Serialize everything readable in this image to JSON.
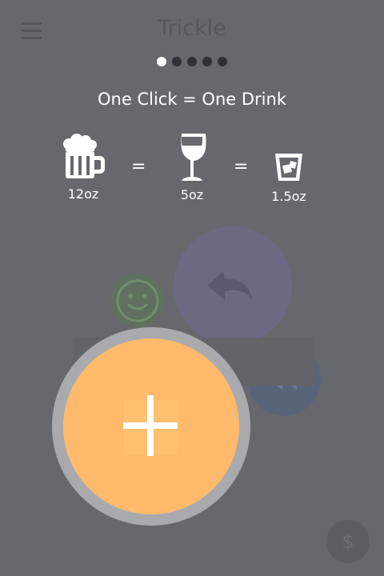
{
  "app": {
    "title": "Trickle"
  },
  "header": {
    "menu_icon": "hamburger-menu-icon"
  },
  "pager": {
    "total": 5,
    "active_index": 0
  },
  "tutorial": {
    "headline": "One Click = One Drink",
    "equals": "=",
    "drinks": [
      {
        "icon": "beer-mug-icon",
        "label": "12oz"
      },
      {
        "icon": "wine-glass-icon",
        "label": "5oz"
      },
      {
        "icon": "whiskey-glass-icon",
        "label": "1.5oz"
      }
    ]
  },
  "buttons": {
    "add_icon": "plus-icon",
    "undo_icon": "undo-icon",
    "mood_icon": "smiley-icon",
    "rewind_icon": "rewind-icon",
    "dollar_label": "$"
  },
  "colors": {
    "overlay_background": "#67686d",
    "add_button": "#ffba6b",
    "undo_button": "#6c6a83",
    "mood_button": "#5f705f",
    "rewind_button": "#5a6478"
  }
}
